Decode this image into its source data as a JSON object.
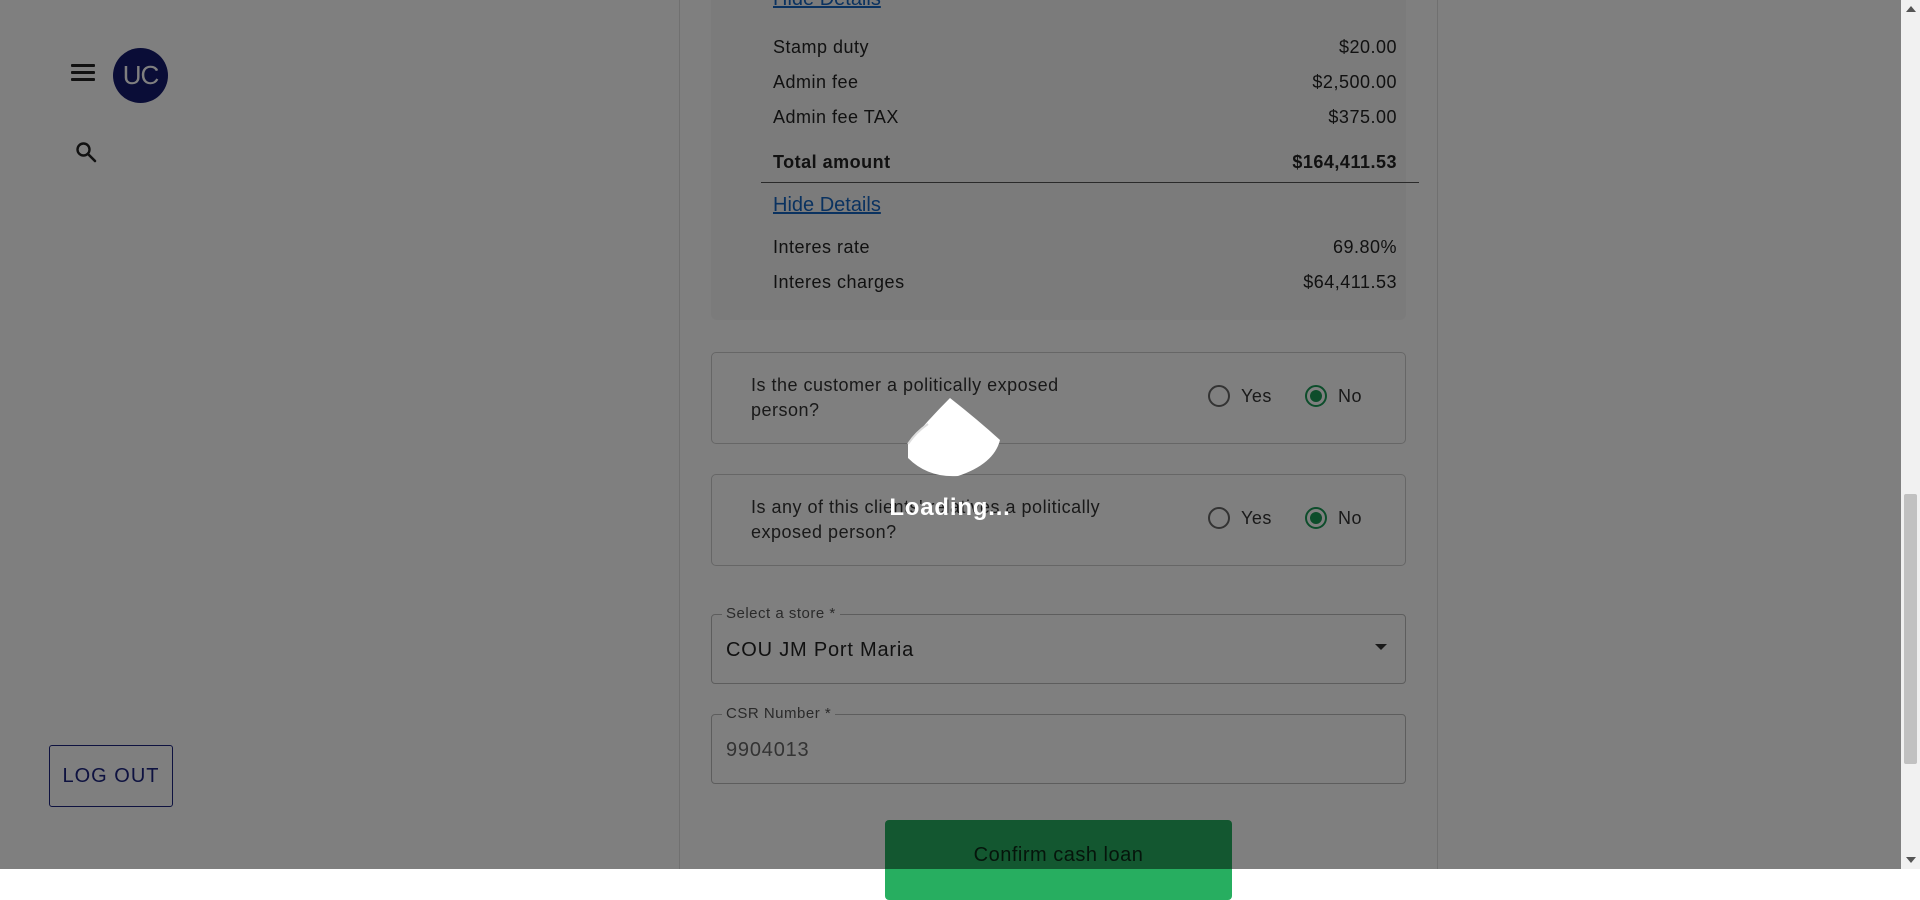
{
  "sidebar": {
    "avatar_initials": "UC",
    "logout_label": "LOG OUT"
  },
  "details": {
    "hide_details_1": "Hide Details",
    "fees": [
      {
        "label": "Stamp duty",
        "value": "$20.00"
      },
      {
        "label": "Admin fee",
        "value": "$2,500.00"
      },
      {
        "label": "Admin fee TAX",
        "value": "$375.00"
      }
    ],
    "total": {
      "label": "Total amount",
      "value": "$164,411.53"
    },
    "hide_details_2": "Hide Details",
    "interest": [
      {
        "label": "Interes rate",
        "value": "69.80%"
      },
      {
        "label": "Interes charges",
        "value": "$64,411.53"
      }
    ]
  },
  "questions": [
    {
      "text": "Is the customer a politically exposed person?",
      "yes_label": "Yes",
      "no_label": "No",
      "selected": "No"
    },
    {
      "text": "Is any of this clients' relatives a politically exposed person?",
      "yes_label": "Yes",
      "no_label": "No",
      "selected": "No"
    }
  ],
  "store_select": {
    "label": "Select a store *",
    "value": "COU JM Port Maria"
  },
  "csr_field": {
    "label": "CSR Number *",
    "value": "9904013"
  },
  "confirm_button": {
    "label": "Confirm cash loan"
  },
  "overlay": {
    "loading_text": "Loading..."
  },
  "colors": {
    "brand": "#141a6e",
    "success": "#1a9b57",
    "link": "#1565c0",
    "confirm_bg": "#27ae60"
  },
  "icons": [
    "menu-icon",
    "search-icon",
    "chevron-down-icon",
    "loading-spinner-icon"
  ]
}
